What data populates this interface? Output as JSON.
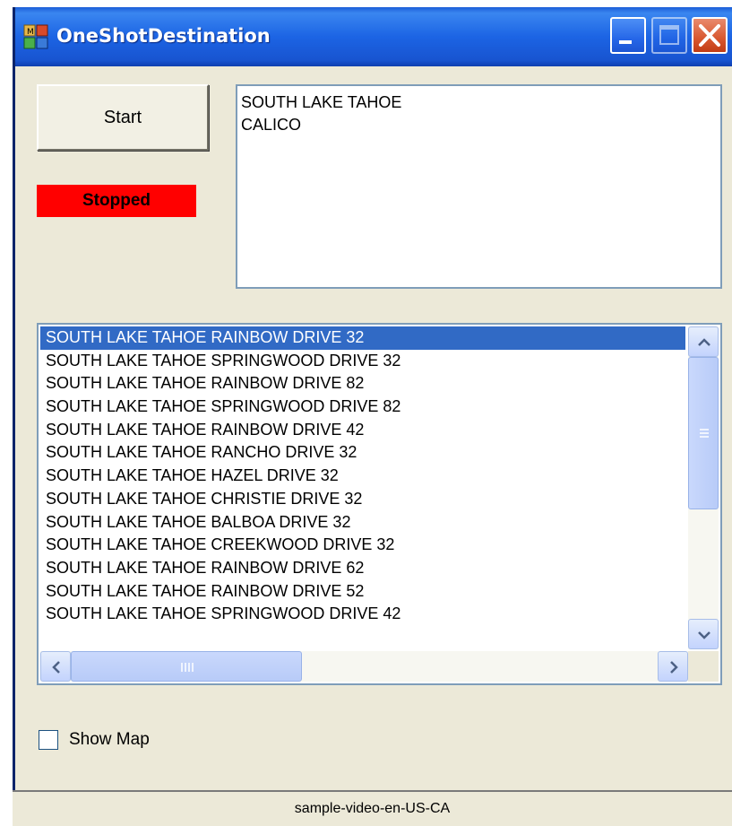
{
  "window": {
    "title": "OneShotDestination",
    "controls": {
      "minimize_icon": "minimize-icon",
      "maximize_icon": "maximize-icon",
      "close_icon": "close-icon"
    }
  },
  "controls": {
    "start_label": "Start",
    "status_text": "Stopped",
    "status_color": "#ff0000"
  },
  "destinations": [
    "SOUTH LAKE TAHOE",
    "CALICO"
  ],
  "results": {
    "selected_index": 0,
    "items": [
      "SOUTH LAKE TAHOE RAINBOW DRIVE 32",
      "SOUTH LAKE TAHOE SPRINGWOOD DRIVE 32",
      "SOUTH LAKE TAHOE RAINBOW DRIVE 82",
      "SOUTH LAKE TAHOE SPRINGWOOD DRIVE 82",
      "SOUTH LAKE TAHOE RAINBOW DRIVE 42",
      "SOUTH LAKE TAHOE RANCHO DRIVE 32",
      "SOUTH LAKE TAHOE HAZEL DRIVE 32",
      "SOUTH LAKE TAHOE CHRISTIE DRIVE 32",
      "SOUTH LAKE TAHOE BALBOA DRIVE 32",
      "SOUTH LAKE TAHOE CREEKWOOD DRIVE 32",
      "SOUTH LAKE TAHOE RAINBOW DRIVE 62",
      "SOUTH LAKE TAHOE RAINBOW DRIVE 52",
      "SOUTH LAKE TAHOE SPRINGWOOD DRIVE 42"
    ]
  },
  "options": {
    "show_map_label": "Show Map",
    "show_map_checked": false
  },
  "footer": {
    "caption": "sample-video-en-US-CA"
  },
  "colors": {
    "selection": "#316ac5",
    "titlebar": "#1c64e4",
    "dialog_bg": "#ece9d8"
  }
}
